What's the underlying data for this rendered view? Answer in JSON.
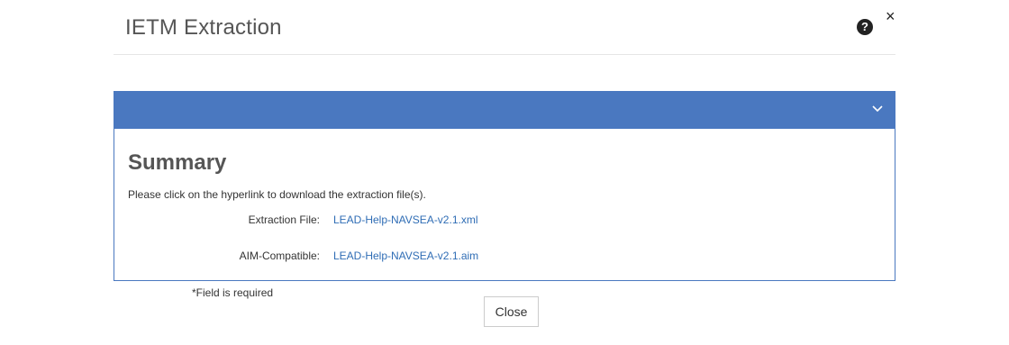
{
  "modal": {
    "title": "IETM Extraction",
    "help_icon": "question-circle-icon",
    "close_icon": "×"
  },
  "panel": {
    "color": "#4a78c0",
    "chevron_icon": "chevron-down-icon",
    "summary_title": "Summary",
    "instructions": "Please click on the hyperlink to download the extraction file(s).",
    "rows": [
      {
        "label": "Extraction File:",
        "link": "LEAD-Help-NAVSEA-v2.1.xml"
      },
      {
        "label": "AIM-Compatible:",
        "link": "LEAD-Help-NAVSEA-v2.1.aim"
      }
    ]
  },
  "footer": {
    "required_note": "*Field is required",
    "close_label": "Close"
  }
}
